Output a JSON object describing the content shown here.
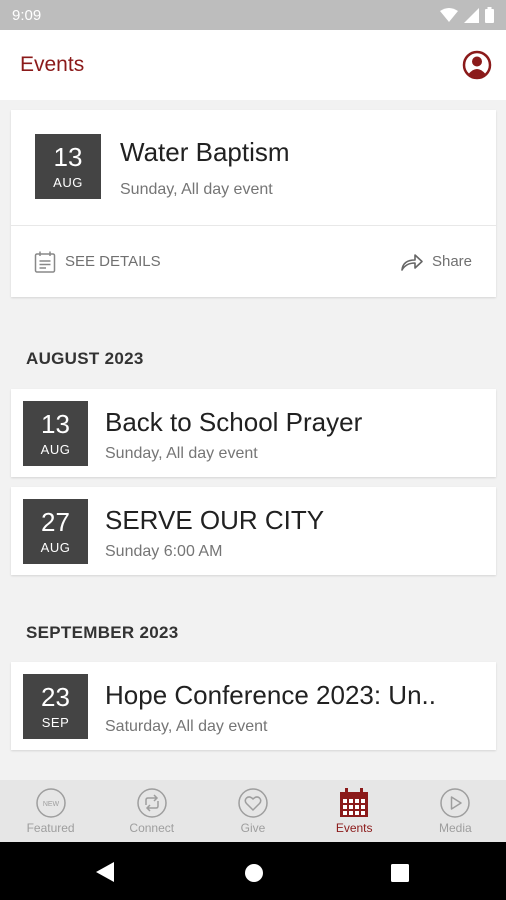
{
  "status": {
    "time": "9:09"
  },
  "header": {
    "title": "Events"
  },
  "featured": {
    "day": "13",
    "month": "AUG",
    "title": "Water Baptism",
    "subtitle": "Sunday, All day event",
    "details_label": "SEE DETAILS",
    "share_label": "Share"
  },
  "sections": [
    {
      "title": "AUGUST 2023",
      "events": [
        {
          "day": "13",
          "month": "AUG",
          "title": "Back to School Prayer",
          "subtitle": "Sunday, All day event"
        },
        {
          "day": "27",
          "month": "AUG",
          "title": "SERVE OUR CITY",
          "subtitle": "Sunday 6:00 AM"
        }
      ]
    },
    {
      "title": "SEPTEMBER 2023",
      "events": [
        {
          "day": "23",
          "month": "SEP",
          "title": "Hope Conference 2023: Un..",
          "subtitle": "Saturday, All day event"
        }
      ]
    }
  ],
  "nav": {
    "items": [
      {
        "label": "Featured",
        "icon": "new-badge-icon"
      },
      {
        "label": "Connect",
        "icon": "connect-arrows-icon"
      },
      {
        "label": "Give",
        "icon": "heart-icon"
      },
      {
        "label": "Events",
        "icon": "calendar-icon",
        "active": true
      },
      {
        "label": "Media",
        "icon": "play-icon"
      }
    ]
  },
  "colors": {
    "accent": "#8b1a1a",
    "date_box": "#444444"
  }
}
